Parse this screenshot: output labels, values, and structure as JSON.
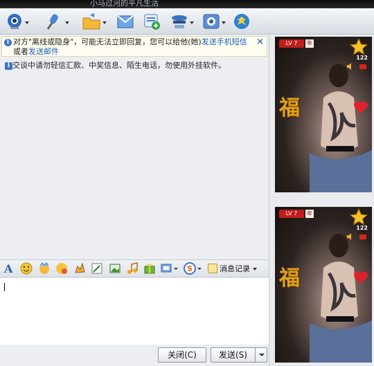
{
  "titlebar": {
    "text": "小马过河的平凡生活"
  },
  "toolbar": {
    "items": [
      {
        "name": "video-call",
        "icon": "webcam-icon",
        "has_menu": true
      },
      {
        "name": "voice-call",
        "icon": "microphone-icon",
        "has_menu": true
      },
      {
        "name": "send-file",
        "icon": "folder-icon",
        "has_menu": true
      },
      {
        "name": "send-sms",
        "icon": "mail-icon",
        "has_menu": false
      },
      {
        "name": "group-chat",
        "icon": "add-chat-icon",
        "has_menu": false
      },
      {
        "name": "remote-assist",
        "icon": "remote-icon",
        "has_menu": true
      },
      {
        "name": "apps",
        "icon": "app-settings-icon",
        "has_menu": true
      },
      {
        "name": "space",
        "icon": "qzone-icon",
        "has_menu": false
      }
    ]
  },
  "notice": {
    "text_before": "对方\"离线或隐身\"，可能无法立即回复，您可以给他(她)",
    "link1": "发送手机短信",
    "middle": "或者",
    "link2": "发送邮件",
    "close": "×"
  },
  "warning": {
    "text": "交谈中请勿轻信汇款、中奖信息、陌生电话，勿使用外挂软件。"
  },
  "format_bar": {
    "icons": [
      "font-icon",
      "smiley-icon",
      "magic-face-icon",
      "wink-icon",
      "shake-icon",
      "scribble-icon",
      "image-icon",
      "music-icon",
      "gift-icon",
      "screenshot-icon",
      "soso-icon"
    ],
    "message_log": "消息记录"
  },
  "buttons": {
    "close": "关闭(C)",
    "send": "发送(S)"
  },
  "shows": [
    {
      "level": "LV 7",
      "year": "年",
      "stars": "122",
      "deco": "福"
    },
    {
      "level": "LV 7",
      "year": "年",
      "stars": "122",
      "deco": "福"
    }
  ],
  "colors": {
    "accent": "#1a5cb8",
    "notice_bg": "#fffdf1",
    "badge_red": "#c21d1d"
  }
}
